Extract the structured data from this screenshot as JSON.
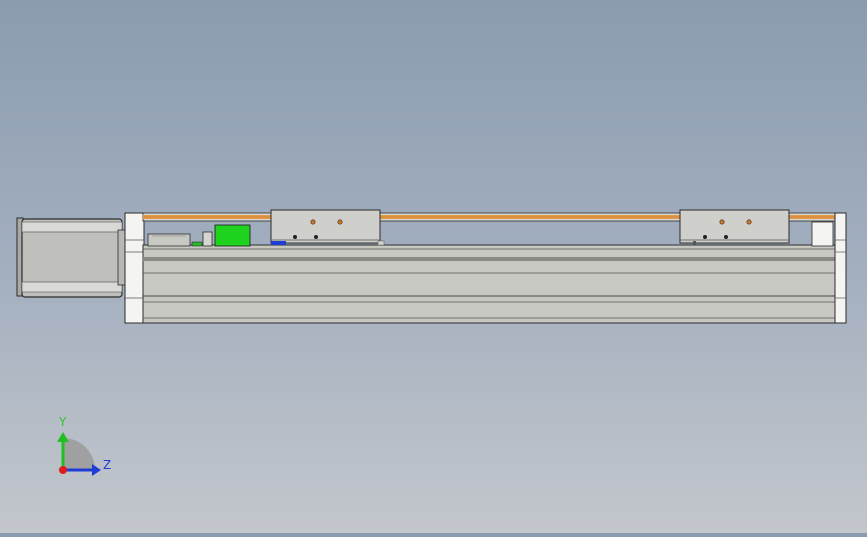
{
  "viewport": {
    "background_top": "#8b9bb0",
    "background_bottom": "#c3c7cc"
  },
  "model": {
    "name": "linear-actuator-module",
    "components": [
      "stepper-motor",
      "aluminum-profile-base",
      "slide-carriage-left",
      "slide-carriage-right",
      "belt-rail",
      "limit-sensor",
      "motor-mount-block",
      "end-cap-block"
    ],
    "colors": {
      "profile": "#c8c8c3",
      "rail_orange": "#e49a4a",
      "carriage": "#cfcfcb",
      "sensor_green": "#1ed21e",
      "motor": "#bfc0bc",
      "outline": "#2b2b2b"
    }
  },
  "triad": {
    "y_label": "Y",
    "z_label": "Z",
    "colors": {
      "x": "#e01b1b",
      "y": "#20c020",
      "z": "#1f3cd6"
    }
  }
}
